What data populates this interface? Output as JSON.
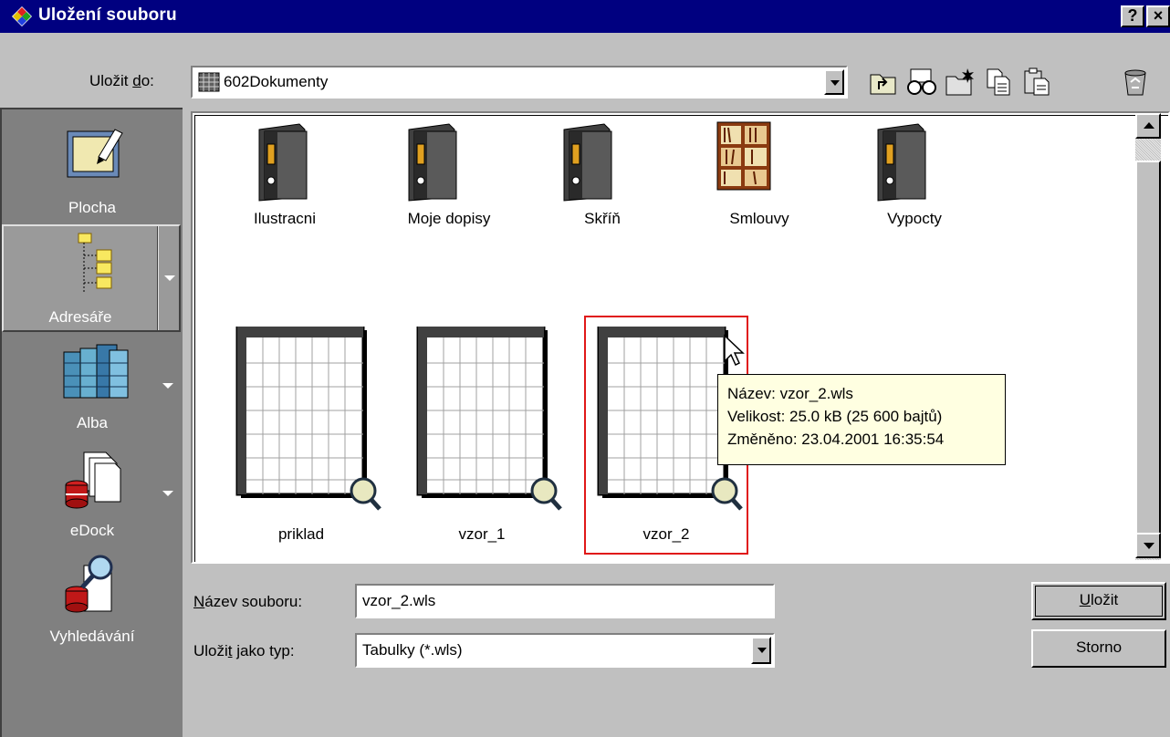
{
  "window": {
    "title": "Uložení souboru",
    "help_label": "?",
    "close_label": "×"
  },
  "save_in": {
    "label_pre": "Uložit ",
    "label_accel": "d",
    "label_post": "o:",
    "value": "602Dokumenty",
    "folder_icon": "folder-grid-icon"
  },
  "toolbar": [
    {
      "name": "up-folder-icon"
    },
    {
      "name": "view-glasses-icon"
    },
    {
      "name": "new-folder-icon"
    },
    {
      "name": "copy-icon"
    },
    {
      "name": "paste-icon"
    },
    {
      "name": "recycle-bin-icon"
    }
  ],
  "places": [
    {
      "label": "Plocha",
      "icon": "desktop-icon",
      "has_menu": false
    },
    {
      "label": "Adresáře",
      "icon": "folder-tree-icon",
      "has_menu": true,
      "selected": true
    },
    {
      "label": "Alba",
      "icon": "albums-icon",
      "has_menu": true
    },
    {
      "label": "eDock",
      "icon": "edock-icon",
      "has_menu": true
    },
    {
      "label": "Vyhledávání",
      "icon": "search-icon",
      "has_menu": false
    }
  ],
  "folders": [
    {
      "label": "Ilustracni",
      "icon": "binder-icon"
    },
    {
      "label": "Moje dopisy",
      "icon": "binder-icon"
    },
    {
      "label": "Skříň",
      "icon": "binder-icon"
    },
    {
      "label": "Smlouvy",
      "icon": "bookcase-icon"
    },
    {
      "label": "Vypocty",
      "icon": "binder-icon"
    }
  ],
  "files": [
    {
      "label": "priklad",
      "icon": "spreadsheet-icon"
    },
    {
      "label": "vzor_1",
      "icon": "spreadsheet-icon"
    },
    {
      "label": "vzor_2",
      "icon": "spreadsheet-icon",
      "selected": true
    }
  ],
  "tooltip": {
    "line1": "Název: vzor_2.wls",
    "line2": "Velikost: 25.0 kB (25 600 bajtů)",
    "line3": "Změněno: 23.04.2001 16:35:54"
  },
  "form": {
    "filename_label_accel": "N",
    "filename_label_rest": "ázev souboru:",
    "filename_value": "vzor_2.wls",
    "type_label_pre": "Uloži",
    "type_label_accel": "t",
    "type_label_post": " jako typ:",
    "type_value": "Tabulky (*.wls)"
  },
  "buttons": {
    "save_accel": "U",
    "save_rest": "ložit",
    "cancel": "Storno"
  },
  "colors": {
    "titlebar": "#000080",
    "window": "#c0c0c0",
    "places_bar": "#808080",
    "tooltip_bg": "#ffffe1",
    "selection_border": "#e01818"
  }
}
